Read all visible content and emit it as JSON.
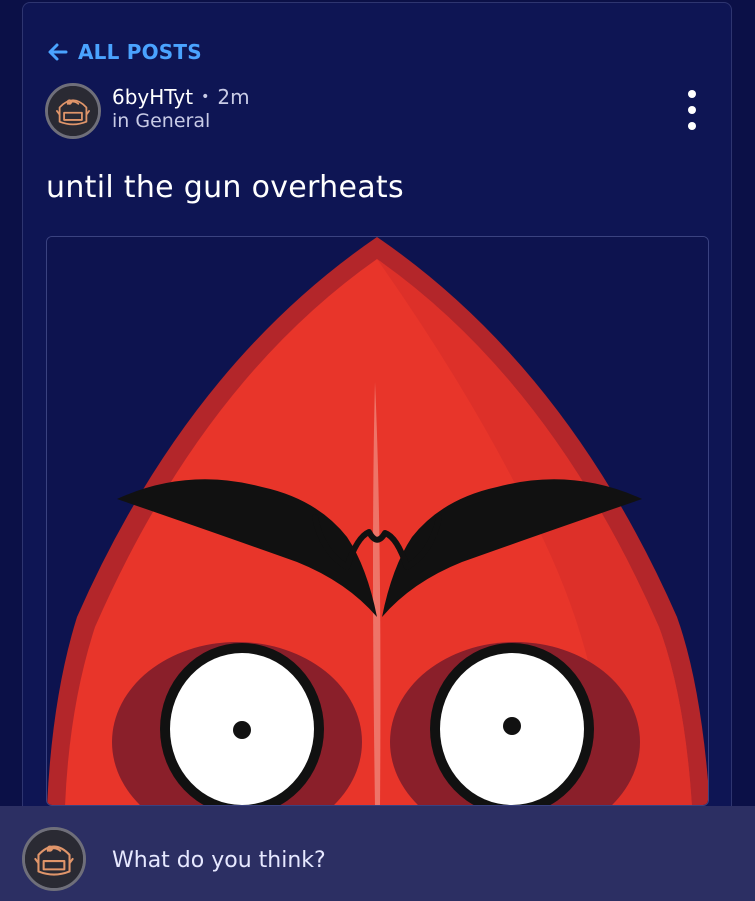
{
  "nav": {
    "back_label": "ALL POSTS"
  },
  "post": {
    "author": "6byHTyt",
    "separator": "•",
    "time": "2m",
    "category": "in General",
    "title": "until the gun overheats"
  },
  "icons": {
    "back": "arrow-left-icon",
    "more": "vertical-dots-icon",
    "avatar": "backpack-avatar"
  },
  "composer": {
    "placeholder": "What do you think?"
  },
  "colors": {
    "background": "#0b1047",
    "card": "#0e1554",
    "link": "#4aa3ff",
    "composer": "#2c2f63",
    "image_red": "#e8352a"
  }
}
